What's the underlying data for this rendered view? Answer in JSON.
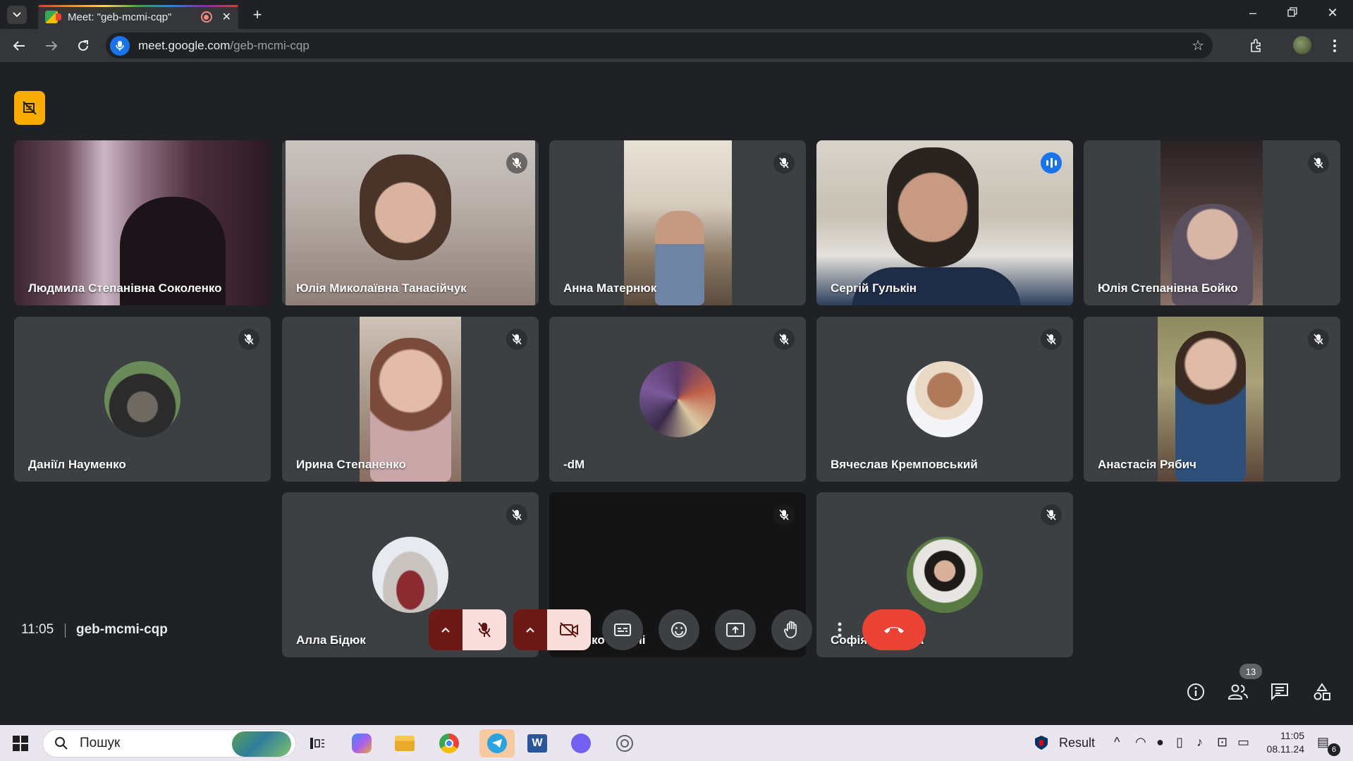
{
  "browser": {
    "tab_title": "Meet: \"geb-mcmi-cqp\"",
    "url_host": "meet.google.com",
    "url_path": "/geb-mcmi-cqp"
  },
  "participants": [
    {
      "name": "Людмила Степанівна Соколенко",
      "muted": false
    },
    {
      "name": "Юлія Миколаївна Танасійчук",
      "muted": true
    },
    {
      "name": "Анна Матернюк",
      "muted": true
    },
    {
      "name": "Сергій Гулькін",
      "muted": false,
      "speaking": true
    },
    {
      "name": "Юлія Степанівна Бойко",
      "muted": true
    },
    {
      "name": "Даніїл Науменко",
      "muted": true
    },
    {
      "name": "Ирина Степаненко",
      "muted": true
    },
    {
      "name": "-dM",
      "muted": true
    },
    {
      "name": "Вячеслав Кремповський",
      "muted": true
    },
    {
      "name": "Анастасія Рябич",
      "muted": true
    },
    {
      "name": "Алла Бідюк",
      "muted": true
    },
    {
      "name": "яценко наталі",
      "muted": true
    },
    {
      "name": "Софія Теміцька",
      "muted": true
    }
  ],
  "meeting": {
    "time": "11:05",
    "code": "geb-mcmi-cqp",
    "people_count": "13"
  },
  "taskbar": {
    "search_placeholder": "Пошук",
    "weather_label": "Result",
    "time": "11:05",
    "date": "08.11.24",
    "notification_count": "6"
  },
  "colors": {
    "meet_bg": "#202124",
    "tile_bg": "#3c4043",
    "end_call": "#ea4335",
    "speaking_outline": "#8ab4f8",
    "host_badge": "#f9ab00"
  }
}
